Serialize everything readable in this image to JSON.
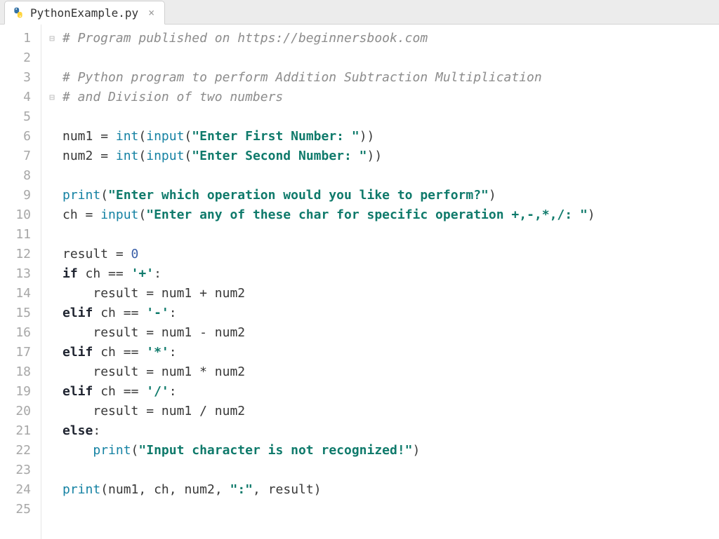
{
  "tab": {
    "filename": "PythonExample.py",
    "close_glyph": "×"
  },
  "gutter": {
    "lines": [
      "1",
      "2",
      "3",
      "4",
      "5",
      "6",
      "7",
      "8",
      "9",
      "10",
      "11",
      "12",
      "13",
      "14",
      "15",
      "16",
      "17",
      "18",
      "19",
      "20",
      "21",
      "22",
      "23",
      "24",
      "25"
    ]
  },
  "fold": {
    "row1_glyph": "⊟",
    "row4_glyph": "⊟"
  },
  "code": {
    "l1": {
      "comment": "# Program published on https://beginnersbook.com"
    },
    "l3": {
      "comment": "# Python program to perform Addition Subtraction Multiplication"
    },
    "l4": {
      "comment": "# and Division of two numbers"
    },
    "l6": {
      "assign_var": "num1",
      "eq": " = ",
      "fn1": "int",
      "op": "(",
      "fn2": "input",
      "op2": "(",
      "str": "\"Enter First Number: \"",
      "close": "))"
    },
    "l7": {
      "assign_var": "num2",
      "eq": " = ",
      "fn1": "int",
      "op": "(",
      "fn2": "input",
      "op2": "(",
      "str": "\"Enter Second Number: \"",
      "close": "))"
    },
    "l9": {
      "fn": "print",
      "op": "(",
      "str": "\"Enter which operation would you like to perform?\"",
      "close": ")"
    },
    "l10": {
      "assign_var": "ch",
      "eq": " = ",
      "fn": "input",
      "op": "(",
      "str": "\"Enter any of these char for specific operation +,-,*,/: \"",
      "close": ")"
    },
    "l12": {
      "assign_var": "result",
      "eq": " = ",
      "num": "0"
    },
    "l13": {
      "kw": "if",
      "sp": " ",
      "var": "ch",
      "eq": " == ",
      "str": "'+'",
      "colon": ":"
    },
    "l14": {
      "indent": "    ",
      "var": "result",
      "eq": " = ",
      "a": "num1",
      "op": " + ",
      "b": "num2"
    },
    "l15": {
      "kw": "elif",
      "sp": " ",
      "var": "ch",
      "eq": " == ",
      "str": "'-'",
      "colon": ":"
    },
    "l16": {
      "indent": "    ",
      "var": "result",
      "eq": " = ",
      "a": "num1",
      "op": " - ",
      "b": "num2"
    },
    "l17": {
      "kw": "elif",
      "sp": " ",
      "var": "ch",
      "eq": " == ",
      "str": "'*'",
      "colon": ":"
    },
    "l18": {
      "indent": "    ",
      "var": "result",
      "eq": " = ",
      "a": "num1",
      "op": " * ",
      "b": "num2"
    },
    "l19": {
      "kw": "elif",
      "sp": " ",
      "var": "ch",
      "eq": " == ",
      "str": "'/'",
      "colon": ":"
    },
    "l20": {
      "indent": "    ",
      "var": "result",
      "eq": " = ",
      "a": "num1",
      "op": " / ",
      "b": "num2"
    },
    "l21": {
      "kw": "else",
      "colon": ":"
    },
    "l22": {
      "indent": "    ",
      "fn": "print",
      "op": "(",
      "str": "\"Input character is not recognized!\"",
      "close": ")"
    },
    "l24": {
      "fn": "print",
      "op": "(",
      "a": "num1",
      "c1": ", ",
      "b": "ch",
      "c2": ", ",
      "d": "num2",
      "c3": ", ",
      "str": "\":\"",
      "c4": ", ",
      "e": "result",
      "close": ")"
    }
  }
}
